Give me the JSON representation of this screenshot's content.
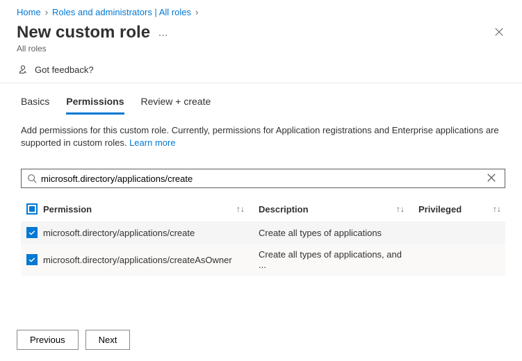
{
  "breadcrumb": {
    "home": "Home",
    "roles": "Roles and administrators | All roles"
  },
  "title": "New custom role",
  "subtitle": "All roles",
  "feedback": "Got feedback?",
  "tabs": {
    "basics": "Basics",
    "permissions": "Permissions",
    "review": "Review + create"
  },
  "description": {
    "text": "Add permissions for this custom role. Currently, permissions for Application registrations and Enterprise applications are supported in custom roles. ",
    "learn_more": "Learn more"
  },
  "search": {
    "value": "microsoft.directory/applications/create"
  },
  "table": {
    "headers": {
      "permission": "Permission",
      "description": "Description",
      "privileged": "Privileged"
    },
    "rows": [
      {
        "permission": "microsoft.directory/applications/create",
        "description": "Create all types of applications"
      },
      {
        "permission": "microsoft.directory/applications/createAsOwner",
        "description": "Create all types of applications, and ..."
      }
    ]
  },
  "footer": {
    "previous": "Previous",
    "next": "Next"
  }
}
